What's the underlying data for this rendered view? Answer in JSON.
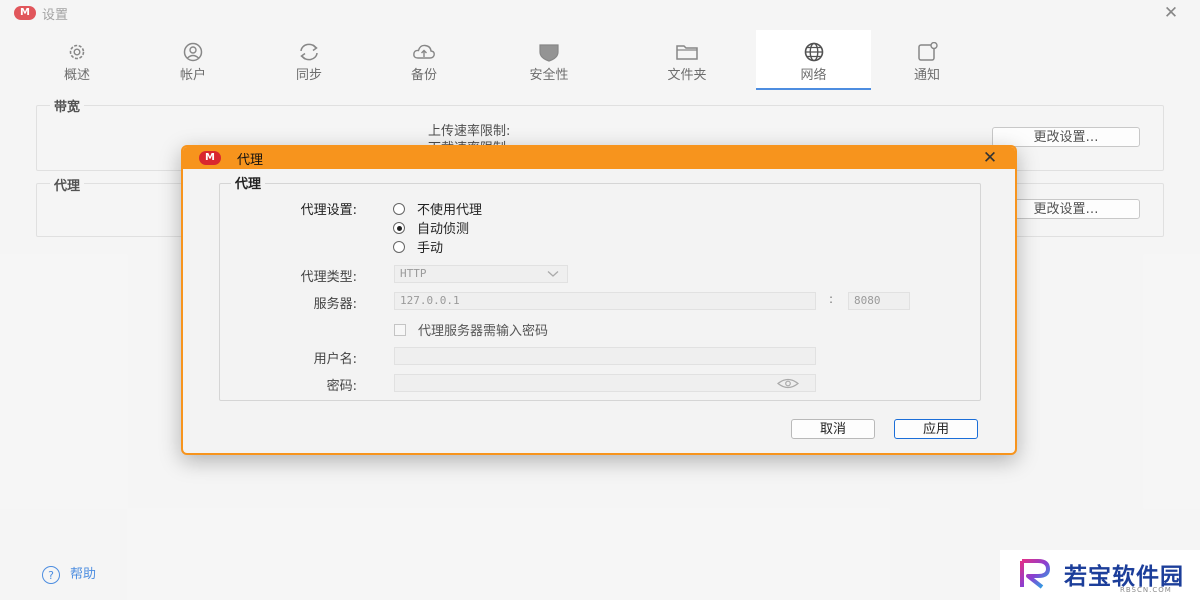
{
  "window": {
    "title": "设置",
    "logo_letter": "M",
    "close_glyph": "✕"
  },
  "tabs": [
    {
      "label": "概述",
      "icon": "gear-icon"
    },
    {
      "label": "帐户",
      "icon": "user-icon"
    },
    {
      "label": "同步",
      "icon": "sync-icon"
    },
    {
      "label": "备份",
      "icon": "cloud-upload-icon"
    },
    {
      "label": "安全性",
      "icon": "shield-icon"
    },
    {
      "label": "文件夹",
      "icon": "folder-icon"
    },
    {
      "label": "网络",
      "icon": "globe-icon",
      "active": true
    },
    {
      "label": "通知",
      "icon": "notification-icon"
    }
  ],
  "bandwidth": {
    "legend": "带宽",
    "upload_label": "上传速率限制:",
    "download_label": "下载速率限制",
    "change_button": "更改设置…"
  },
  "proxy_section": {
    "legend": "代理",
    "change_button": "更改设置…"
  },
  "help": {
    "icon_glyph": "?",
    "label": "帮助"
  },
  "dialog": {
    "title": "代理",
    "group_legend": "代理",
    "proxy_settings_label": "代理设置:",
    "options": [
      {
        "label": "不使用代理",
        "selected": false
      },
      {
        "label": "自动侦测",
        "selected": true
      },
      {
        "label": "手动",
        "selected": false
      }
    ],
    "proxy_type_label": "代理类型:",
    "proxy_type_value": "HTTP",
    "server_label": "服务器:",
    "server_value": "127.0.0.1",
    "port_separator": ":",
    "port_value": "8080",
    "auth_checkbox_label": "代理服务器需输入密码",
    "auth_checked": false,
    "username_label": "用户名:",
    "username_value": "",
    "password_label": "密码:",
    "password_value": "",
    "cancel_button": "取消",
    "apply_button": "应用"
  },
  "watermark": {
    "text": "若宝软件园",
    "subtext": "RBSCN.COM"
  },
  "colors": {
    "accent_orange": "#f7941d",
    "active_tab_underline": "#1b6ed8",
    "brand_red": "#d9272e",
    "watermark_blue": "#1c3e9a"
  }
}
